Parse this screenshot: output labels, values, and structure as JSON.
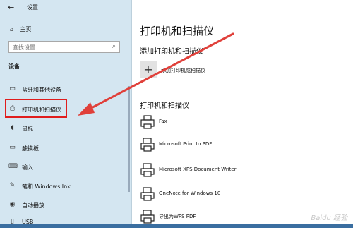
{
  "titlebar": {
    "title": "设置"
  },
  "sidebar": {
    "home": "主页",
    "search_placeholder": "查找设置",
    "section": "设备",
    "items": [
      {
        "label": "蓝牙和其他设备",
        "icon": "bluetooth-devices-icon"
      },
      {
        "label": "打印机和扫描仪",
        "icon": "printer-icon",
        "selected": true
      },
      {
        "label": "鼠标",
        "icon": "mouse-icon"
      },
      {
        "label": "触摸板",
        "icon": "touchpad-icon"
      },
      {
        "label": "输入",
        "icon": "keyboard-icon"
      },
      {
        "label": "笔和 Windows Ink",
        "icon": "pen-icon"
      },
      {
        "label": "自动播放",
        "icon": "autoplay-icon"
      },
      {
        "label": "USB",
        "icon": "usb-icon"
      }
    ]
  },
  "main": {
    "title": "打印机和扫描仪",
    "add_section": "添加打印机和扫描仪",
    "add_button": "添加打印机或扫描仪",
    "list_section": "打印机和扫描仪",
    "devices": [
      {
        "label": "Fax",
        "icon": "fax-icon"
      },
      {
        "label": "Microsoft Print to PDF",
        "icon": "printer-icon"
      },
      {
        "label": "Microsoft XPS Document Writer",
        "icon": "printer-icon"
      },
      {
        "label": "OneNote for Windows 10",
        "icon": "printer-icon"
      },
      {
        "label": "导出为WPS PDF",
        "icon": "printer-icon"
      }
    ]
  },
  "watermark": "Baidu 经验",
  "colors": {
    "sidebar_bg": "#d4e6f1",
    "highlight": "#e01d1d",
    "arrow": "#e0403a"
  }
}
